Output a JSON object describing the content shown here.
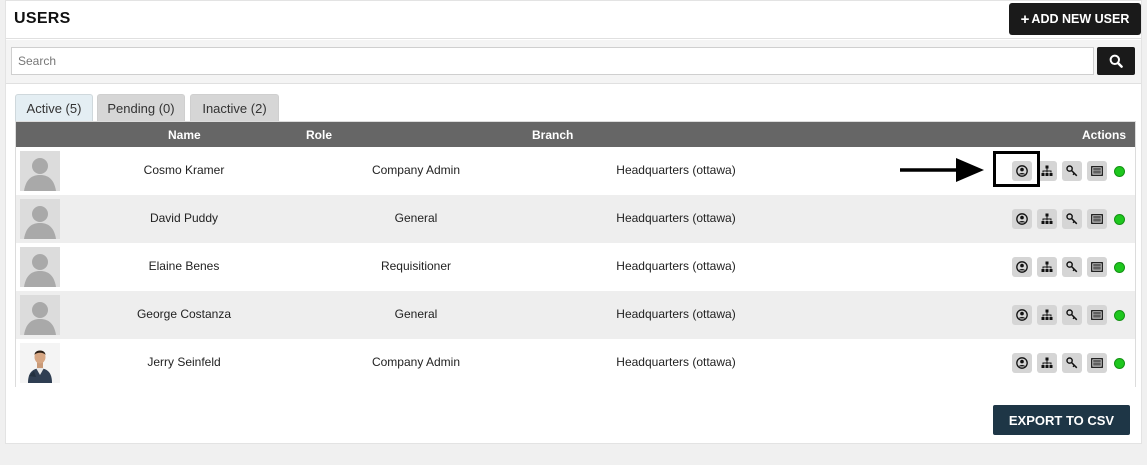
{
  "header": {
    "title": "USERS",
    "add_button_label": "ADD NEW USER"
  },
  "search": {
    "placeholder": "Search",
    "value": ""
  },
  "tabs": [
    {
      "label": "Active (5)",
      "active": true
    },
    {
      "label": "Pending (0)",
      "active": false
    },
    {
      "label": "Inactive (2)",
      "active": false
    }
  ],
  "table": {
    "columns": {
      "name": "Name",
      "role": "Role",
      "branch": "Branch",
      "actions": "Actions"
    },
    "rows": [
      {
        "name": "Cosmo Kramer",
        "role": "Company Admin",
        "branch": "Headquarters (ottawa)",
        "avatar": "placeholder-silhouette",
        "status": "active"
      },
      {
        "name": "David Puddy",
        "role": "General",
        "branch": "Headquarters (ottawa)",
        "avatar": "placeholder-silhouette",
        "status": "active"
      },
      {
        "name": "Elaine Benes",
        "role": "Requisitioner",
        "branch": "Headquarters (ottawa)",
        "avatar": "placeholder-silhouette",
        "status": "active"
      },
      {
        "name": "George Costanza",
        "role": "General",
        "branch": "Headquarters (ottawa)",
        "avatar": "placeholder-silhouette",
        "status": "active"
      },
      {
        "name": "Jerry Seinfeld",
        "role": "Company Admin",
        "branch": "Headquarters (ottawa)",
        "avatar": "photo",
        "status": "active"
      }
    ],
    "action_icons": [
      "user-profile-icon",
      "org-chart-icon",
      "key-icon",
      "card-icon"
    ],
    "status_color": "#1ec71e"
  },
  "footer": {
    "export_label": "EXPORT TO CSV"
  },
  "colors": {
    "header_bar": "#666666",
    "primary_button": "#1a1a1a",
    "export_button": "#1e3646",
    "status_active": "#1ec71e"
  }
}
